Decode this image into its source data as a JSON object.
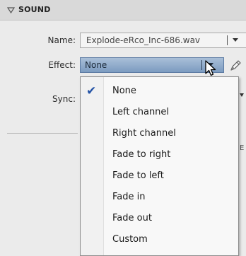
{
  "section": {
    "title": "SOUND"
  },
  "name": {
    "label": "Name:",
    "value": "Explode-eRco_Inc-686.wav"
  },
  "effect": {
    "label": "Effect:",
    "value": "None",
    "options": [
      "None",
      "Left channel",
      "Right channel",
      "Fade to right",
      "Fade to left",
      "Fade in",
      "Fade out",
      "Custom"
    ],
    "selected_index": 0
  },
  "sync": {
    "label": "Sync:"
  },
  "partial_text": {
    "peek": "E"
  },
  "colors": {
    "selected_field": "#8aa6c8",
    "check": "#2453a6",
    "panel": "#ebebeb"
  },
  "icons": {
    "section_toggle": "triangle-down-icon",
    "edit": "pencil-icon",
    "check": "checkmark-icon",
    "cursor": "mouse-pointer-icon"
  }
}
